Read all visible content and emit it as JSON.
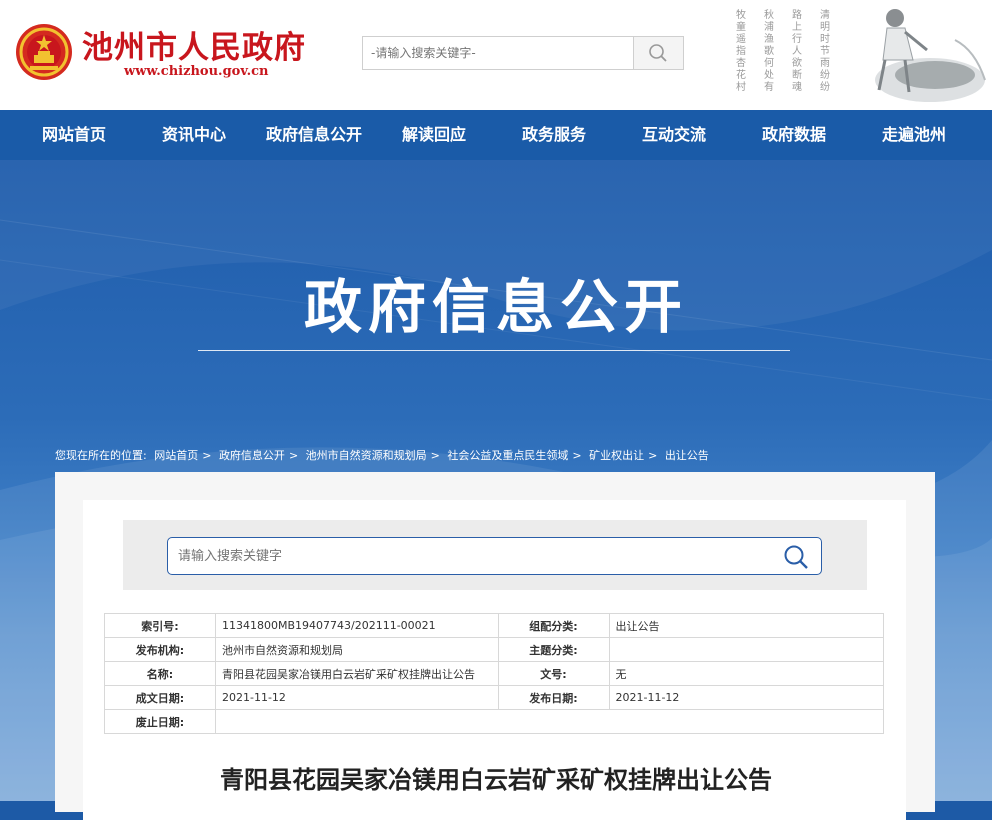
{
  "header": {
    "site_title": "池州市人民政府",
    "site_url": "www.chizhou.gov.cn",
    "search_placeholder": "-请输入搜索关键字-",
    "poem_columns": [
      "牧童遥指杏花村",
      "秋浦渔歌何处有",
      "路上行人欲断魂",
      "清明时节雨纷纷"
    ]
  },
  "nav": {
    "items": [
      "网站首页",
      "资讯中心",
      "政府信息公开",
      "解读回应",
      "政务服务",
      "互动交流",
      "政府数据",
      "走遍池州"
    ]
  },
  "banner": {
    "title": "政府信息公开"
  },
  "breadcrumb": {
    "prefix": "您现在所在的位置:",
    "items": [
      "网站首页",
      "政府信息公开",
      "池州市自然资源和规划局",
      "社会公益及重点民生领域",
      "矿业权出让",
      "出让公告"
    ],
    "separator": ">"
  },
  "content_search": {
    "placeholder": "请输入搜索关键字"
  },
  "meta": {
    "rows": [
      {
        "k1": "索引号:",
        "v1": "11341800MB19407743/202111-00021",
        "k2": "组配分类:",
        "v2": "出让公告"
      },
      {
        "k1": "发布机构:",
        "v1": "池州市自然资源和规划局",
        "k2": "主题分类:",
        "v2": ""
      },
      {
        "k1": "名称:",
        "v1": "青阳县花园吴家冶镁用白云岩矿采矿权挂牌出让公告",
        "k2": "文号:",
        "v2": "无"
      },
      {
        "k1": "成文日期:",
        "v1": "2021-11-12",
        "k2": "发布日期:",
        "v2": "2021-11-12"
      },
      {
        "k1": "废止日期:",
        "v1": ""
      }
    ]
  },
  "article": {
    "title": "青阳县花园吴家冶镁用白云岩矿采矿权挂牌出让公告"
  },
  "colors": {
    "brand_red": "#c8161d",
    "nav_blue": "#1a5ba8",
    "search_border": "#2a5ea8"
  },
  "icons": [
    "national-emblem-icon",
    "search-icon"
  ]
}
